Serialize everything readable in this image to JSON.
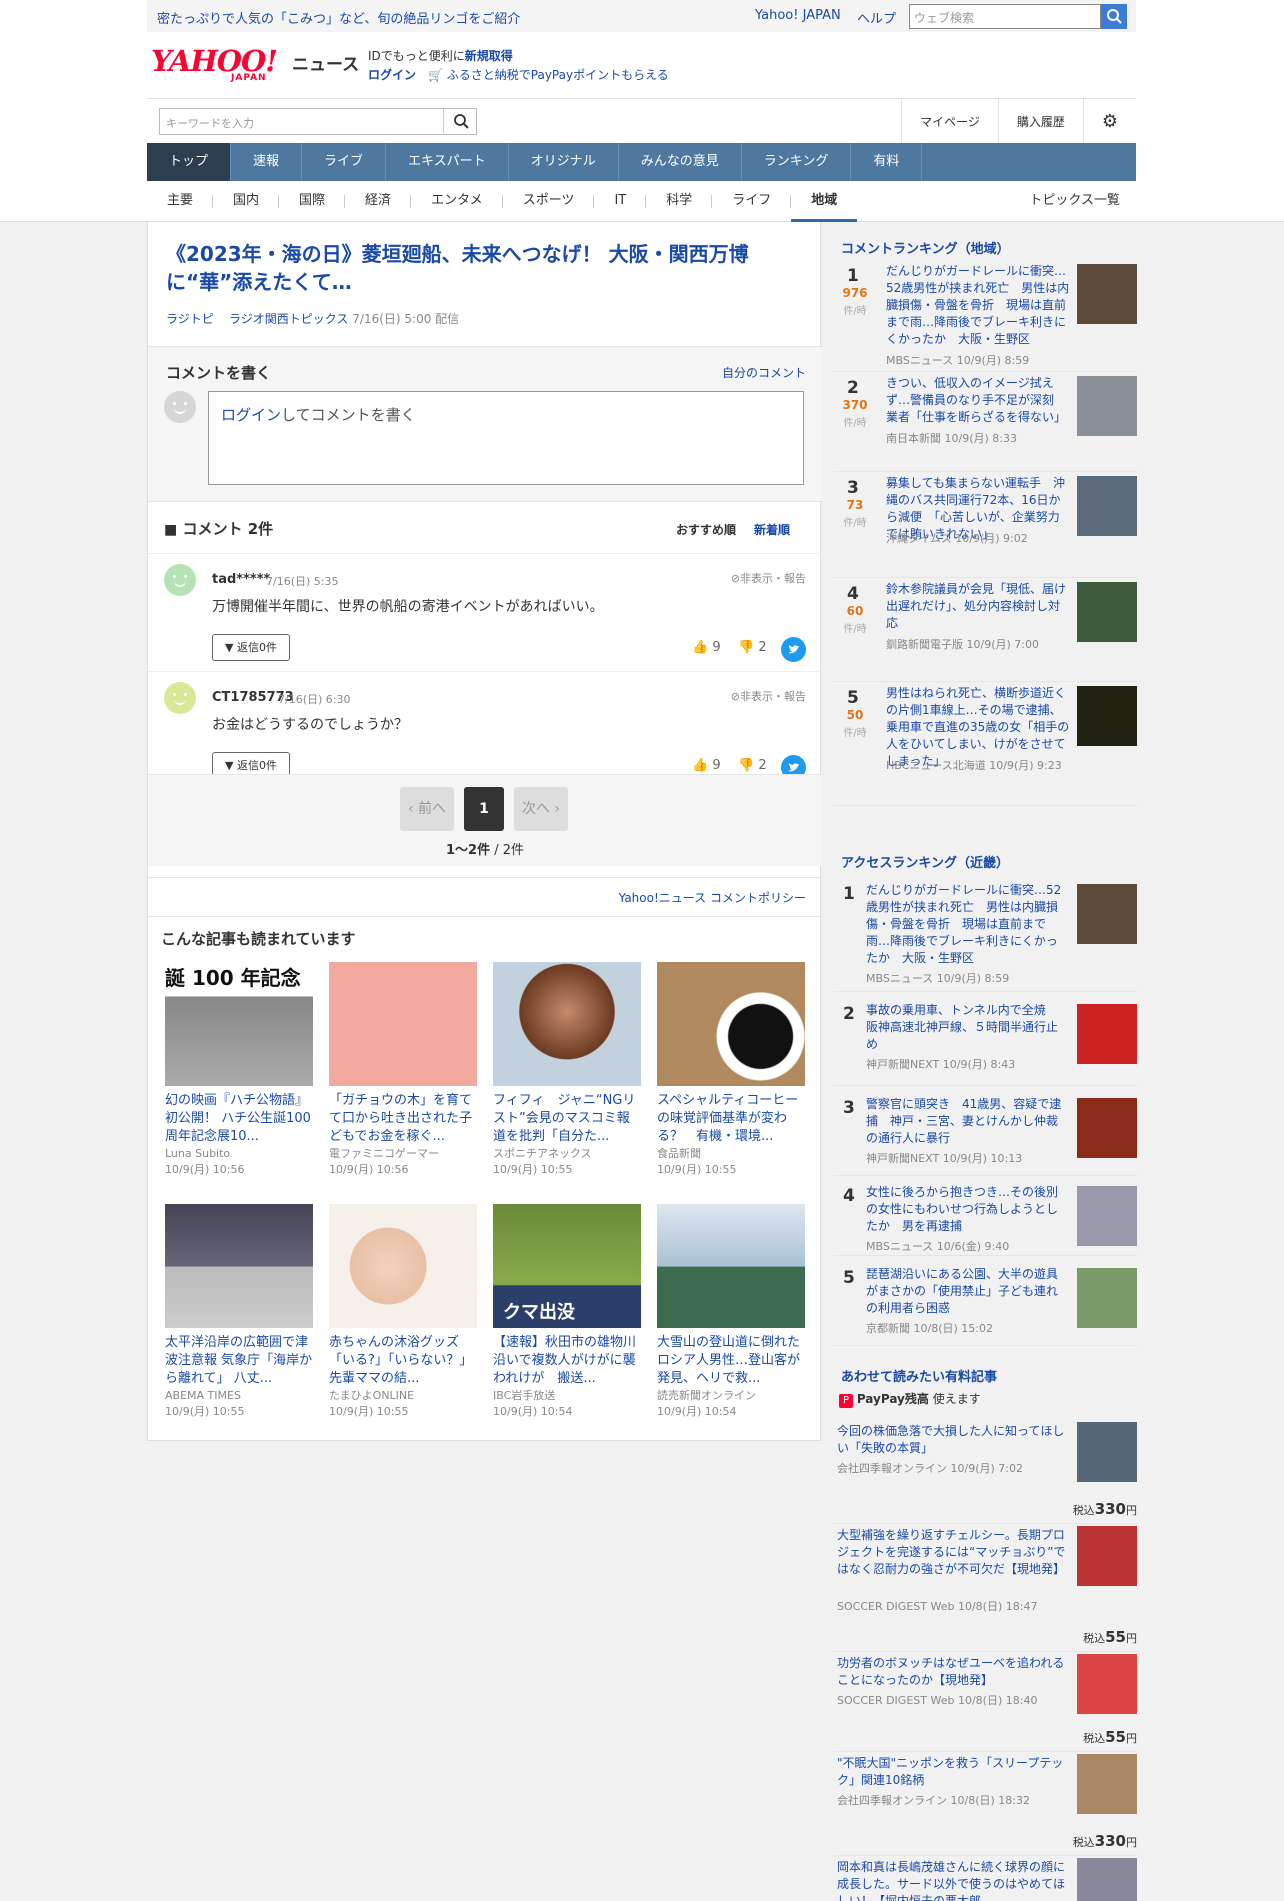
{
  "header": {
    "promo": "密たっぷりで人気の「こみつ」など、旬の絶品リンゴをご紹介",
    "yahoo_link": "Yahoo! JAPAN",
    "help": "ヘルプ",
    "web_search_placeholder": "ウェブ検索",
    "logo_text": "YAHOO!",
    "logo_japan": "JAPAN",
    "logo_news": "ニュース",
    "id_text": "IDでもっと便利に",
    "id_link": "新規取得",
    "login": "ログイン",
    "furusato": "ふるさと納税でPayPayポイントもらえる",
    "keyword_placeholder": "キーワードを入力",
    "mypage": "マイページ",
    "history": "購入履歴"
  },
  "gnav": [
    "トップ",
    "速報",
    "ライブ",
    "エキスパート",
    "オリジナル",
    "みんなの意見",
    "ランキング",
    "有料"
  ],
  "snav": [
    "主要",
    "国内",
    "国際",
    "経済",
    "エンタメ",
    "スポーツ",
    "IT",
    "科学",
    "ライフ",
    "地域"
  ],
  "topics": "トピックス一覧",
  "article": {
    "title": "《2023年・海の日》菱垣廻船、未来へつなげ！ 大阪・関西万博に“華”添えたくて…",
    "source1": "ラジトピ",
    "source2": "ラジオ関西トピックス",
    "date": "7/16(日) 5:00 配信"
  },
  "write": {
    "heading": "コメントを書く",
    "mine": "自分のコメント",
    "login_link": "ログイン",
    "prompt": "してコメントを書く"
  },
  "comments_head": {
    "title": "コメント 2件",
    "recommended": "おすすめ順",
    "newest": "新着順"
  },
  "comments": [
    {
      "user": "tad*****",
      "time": "7/16(日) 5:35",
      "hide": "非表示・報告",
      "body": "万博開催半年間に、世界の帆船の寄港イベントがあればいい。",
      "reply": "返信0件",
      "likes": "9",
      "dislikes": "2"
    },
    {
      "user": "CT1785773",
      "time": "7/16(日) 6:30",
      "hide": "非表示・報告",
      "body": "お金はどうするのでしょうか？",
      "reply": "返信0件",
      "likes": "9",
      "dislikes": "2"
    }
  ],
  "pager": {
    "prev": "前へ",
    "page": "1",
    "next": "次へ",
    "count_bold": "1〜2件",
    "count_total": " / 2件"
  },
  "policy": "Yahoo!ニュース コメントポリシー",
  "recommend": {
    "heading": "こんな記事も読まれています",
    "items": [
      {
        "title": "幻の映画『ハチ公物語』初公開！ ハチ公生誕100周年記念展10...",
        "source": "Luna Subito",
        "date": "10/9(月) 10:56",
        "img_text": "誕 100 年記念"
      },
      {
        "title": "「ガチョウの木」を育てて口から吐き出された子どもでお金を稼ぐ...",
        "source": "電ファミニコゲーマー",
        "date": "10/9(月) 10:56",
        "img_text": ""
      },
      {
        "title": "フィフィ　ジャニ“NGリスト”会見のマスコミ報道を批判「自分た...",
        "source": "スポニチアネックス",
        "date": "10/9(月) 10:55",
        "img_text": ""
      },
      {
        "title": "スペシャルティコーヒーの味覚評価基準が変わる？　有機・環境...",
        "source": "食品新聞",
        "date": "10/9(月) 10:55",
        "img_text": ""
      },
      {
        "title": "太平洋沿岸の広範囲で津波注意報 気象庁「海岸から離れて」 八丈...",
        "source": "ABEMA TIMES",
        "date": "10/9(月) 10:55",
        "img_text": ""
      },
      {
        "title": "赤ちゃんの沐浴グッズ「いる?」「いらない？」先輩ママの結...",
        "source": "たまひよONLINE",
        "date": "10/9(月) 10:55",
        "img_text": ""
      },
      {
        "title": "【速報】秋田市の雄物川沿いで複数人がけがに襲われけが　搬送...",
        "source": "IBC岩手放送",
        "date": "10/9(月) 10:54",
        "img_text": "クマ出没"
      },
      {
        "title": "大雪山の登山道に倒れたロシア人男性…登山客が発見、ヘリで救...",
        "source": "読売新聞オンライン",
        "date": "10/9(月) 10:54",
        "img_text": ""
      }
    ]
  },
  "comment_ranking": {
    "heading": "コメントランキング（地域）",
    "unit": "件/時",
    "items": [
      {
        "rank": "1",
        "count": "976",
        "title": "だんじりがガードレールに衝突…52歳男性が挟まれ死亡　男性は内臓損傷・骨盤を骨折　現場は直前まで雨…降雨後でブレーキ利きにくかったか　大阪・生野区",
        "meta": "MBSニュース 10/9(月) 8:59"
      },
      {
        "rank": "2",
        "count": "370",
        "title": "きつい、低収入のイメージ拭えず…警備員のなり手不足が深刻　業者「仕事を断らざるを得ない」",
        "meta": "南日本新聞 10/9(月) 8:33"
      },
      {
        "rank": "3",
        "count": "73",
        "title": "募集しても集まらない運転手　沖縄のバス共同運行72本、16日から減便　「心苦しいが、企業努力では賄いきれない」",
        "meta": "沖縄タイムス 10/9(月) 9:02"
      },
      {
        "rank": "4",
        "count": "60",
        "title": "鈴木参院議員が会見「現低、届け出遅れだけ」、処分内容検討し対応",
        "meta": "釧路新聞電子版 10/9(月) 7:00"
      },
      {
        "rank": "5",
        "count": "50",
        "title": "男性はねられ死亡、横断歩道近くの片側1車線上…その場で逮捕、乗用車で直進の35歳の女「相手の人をひいてしまい、けがをさせてしまった」",
        "meta": "HBCニュース北海道 10/9(月) 9:23"
      }
    ]
  },
  "access_ranking": {
    "heading": "アクセスランキング（近畿）",
    "items": [
      {
        "rank": "1",
        "title": "だんじりがガードレールに衝突…52歳男性が挟まれ死亡　男性は内臓損傷・骨盤を骨折　現場は直前まで雨…降雨後でブレーキ利きにくかったか　大阪・生野区",
        "meta": "MBSニュース 10/9(月) 8:59"
      },
      {
        "rank": "2",
        "title": "事故の乗用車、トンネル内で全焼　阪神高速北神戸線、５時間半通行止め",
        "meta": "神戸新聞NEXT 10/9(月) 8:43"
      },
      {
        "rank": "3",
        "title": "警察官に頭突き　41歳男、容疑で逮捕　神戸・三宮、妻とけんかし仲裁の通行人に暴行",
        "meta": "神戸新聞NEXT 10/9(月) 10:13"
      },
      {
        "rank": "4",
        "title": "女性に後ろから抱きつき…その後別の女性にもわいせつ行為しようとしたか　男を再逮捕",
        "meta": "MBSニュース 10/6(金) 9:40"
      },
      {
        "rank": "5",
        "title": "琵琶湖沿いにある公園、大半の遊具がまさかの「使用禁止」子ども連れの利用者ら困惑",
        "meta": "京都新聞 10/8(日) 15:02"
      }
    ]
  },
  "paid": {
    "heading": "あわせて読みたい有料記事",
    "paypay": "PayPay残高",
    "paypay_suffix": "使えます",
    "tax": "税込",
    "yen": "円",
    "items": [
      {
        "title": "今回の株価急落で大損した人に知ってほしい「失敗の本質」",
        "meta": "会社四季報オンライン 10/9(月) 7:02",
        "price": "330"
      },
      {
        "title": "大型補強を繰り返すチェルシー。長期プロジェクトを完遂するには“マッチョぶり”ではなく忍耐力の強さが不可欠だ【現地発】",
        "meta": "SOCCER DIGEST Web 10/8(日) 18:47",
        "price": "55"
      },
      {
        "title": "功労者のボヌッチはなぜユーベを追われることになったのか【現地発】",
        "meta": "SOCCER DIGEST Web 10/8(日) 18:40",
        "price": "55"
      },
      {
        "title": "\"不眠大国\"ニッポンを救う「スリープテック」関連10銘柄",
        "meta": "会社四季報オンライン 10/8(日) 18:32",
        "price": "330"
      },
      {
        "title": "岡本和真は長嶋茂雄さんに続く球界の顔に成長した。サード以外で使うのはやめてほしい！【堀内恒夫の悪太郎",
        "meta": "",
        "price": ""
      }
    ]
  }
}
